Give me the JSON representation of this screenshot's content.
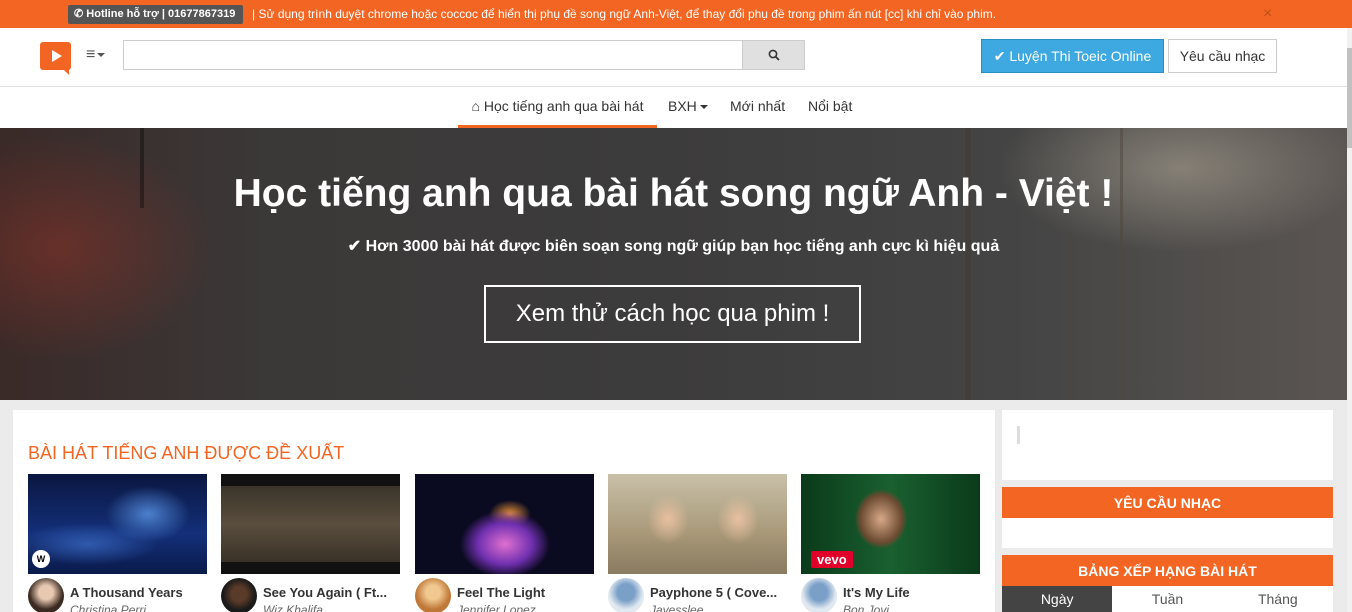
{
  "notice": {
    "hotline": "Hotline hỗ trợ | 01677867319",
    "message": "| Sử dụng trình duyệt chrome hoặc coccoc để hiển thị phụ đề song ngữ Anh-Việt, để thay đổi phụ đề trong phim ấn nút [cc] khi chỉ vào phim.",
    "close": "×"
  },
  "header": {
    "search_placeholder": "",
    "toeic_button": "Luyện Thi Toeic Online",
    "request_button": "Yêu cầu nhạc"
  },
  "nav": {
    "home": "Học tiếng anh qua bài hát",
    "chart": "BXH",
    "newest": "Mới nhất",
    "featured": "Nổi bật"
  },
  "hero": {
    "title": "Học tiếng anh qua bài hát song ngữ Anh - Việt !",
    "subtitle": "Hơn 3000 bài hát được biên soạn song ngữ giúp bạn học tiếng anh cực kì hiệu quả",
    "button": "Xem thử cách học qua phim !"
  },
  "main": {
    "section_title": "BÀI HÁT TIẾNG ANH ĐƯỢC ĐỀ XUẤT",
    "songs": [
      {
        "title": "A Thousand Years",
        "artist": "Christina Perri"
      },
      {
        "title": "See You Again ( Ft...",
        "artist": "Wiz Khalifa"
      },
      {
        "title": "Feel The Light",
        "artist": "Jennifer Lopez"
      },
      {
        "title": "Payphone 5 ( Cove...",
        "artist": "Jayesslee"
      },
      {
        "title": "It's My Life",
        "artist": "Bon Jovi"
      }
    ],
    "vevo_badge": "vevo"
  },
  "sidebar": {
    "request_title": "YÊU CẦU NHẠC",
    "chart_title": "BẢNG XẾP HẠNG BÀI HÁT",
    "tabs": [
      "Ngày",
      "Tuần",
      "Tháng"
    ]
  },
  "colors": {
    "accent": "#f26522",
    "toeic_blue": "#3da9e0"
  }
}
